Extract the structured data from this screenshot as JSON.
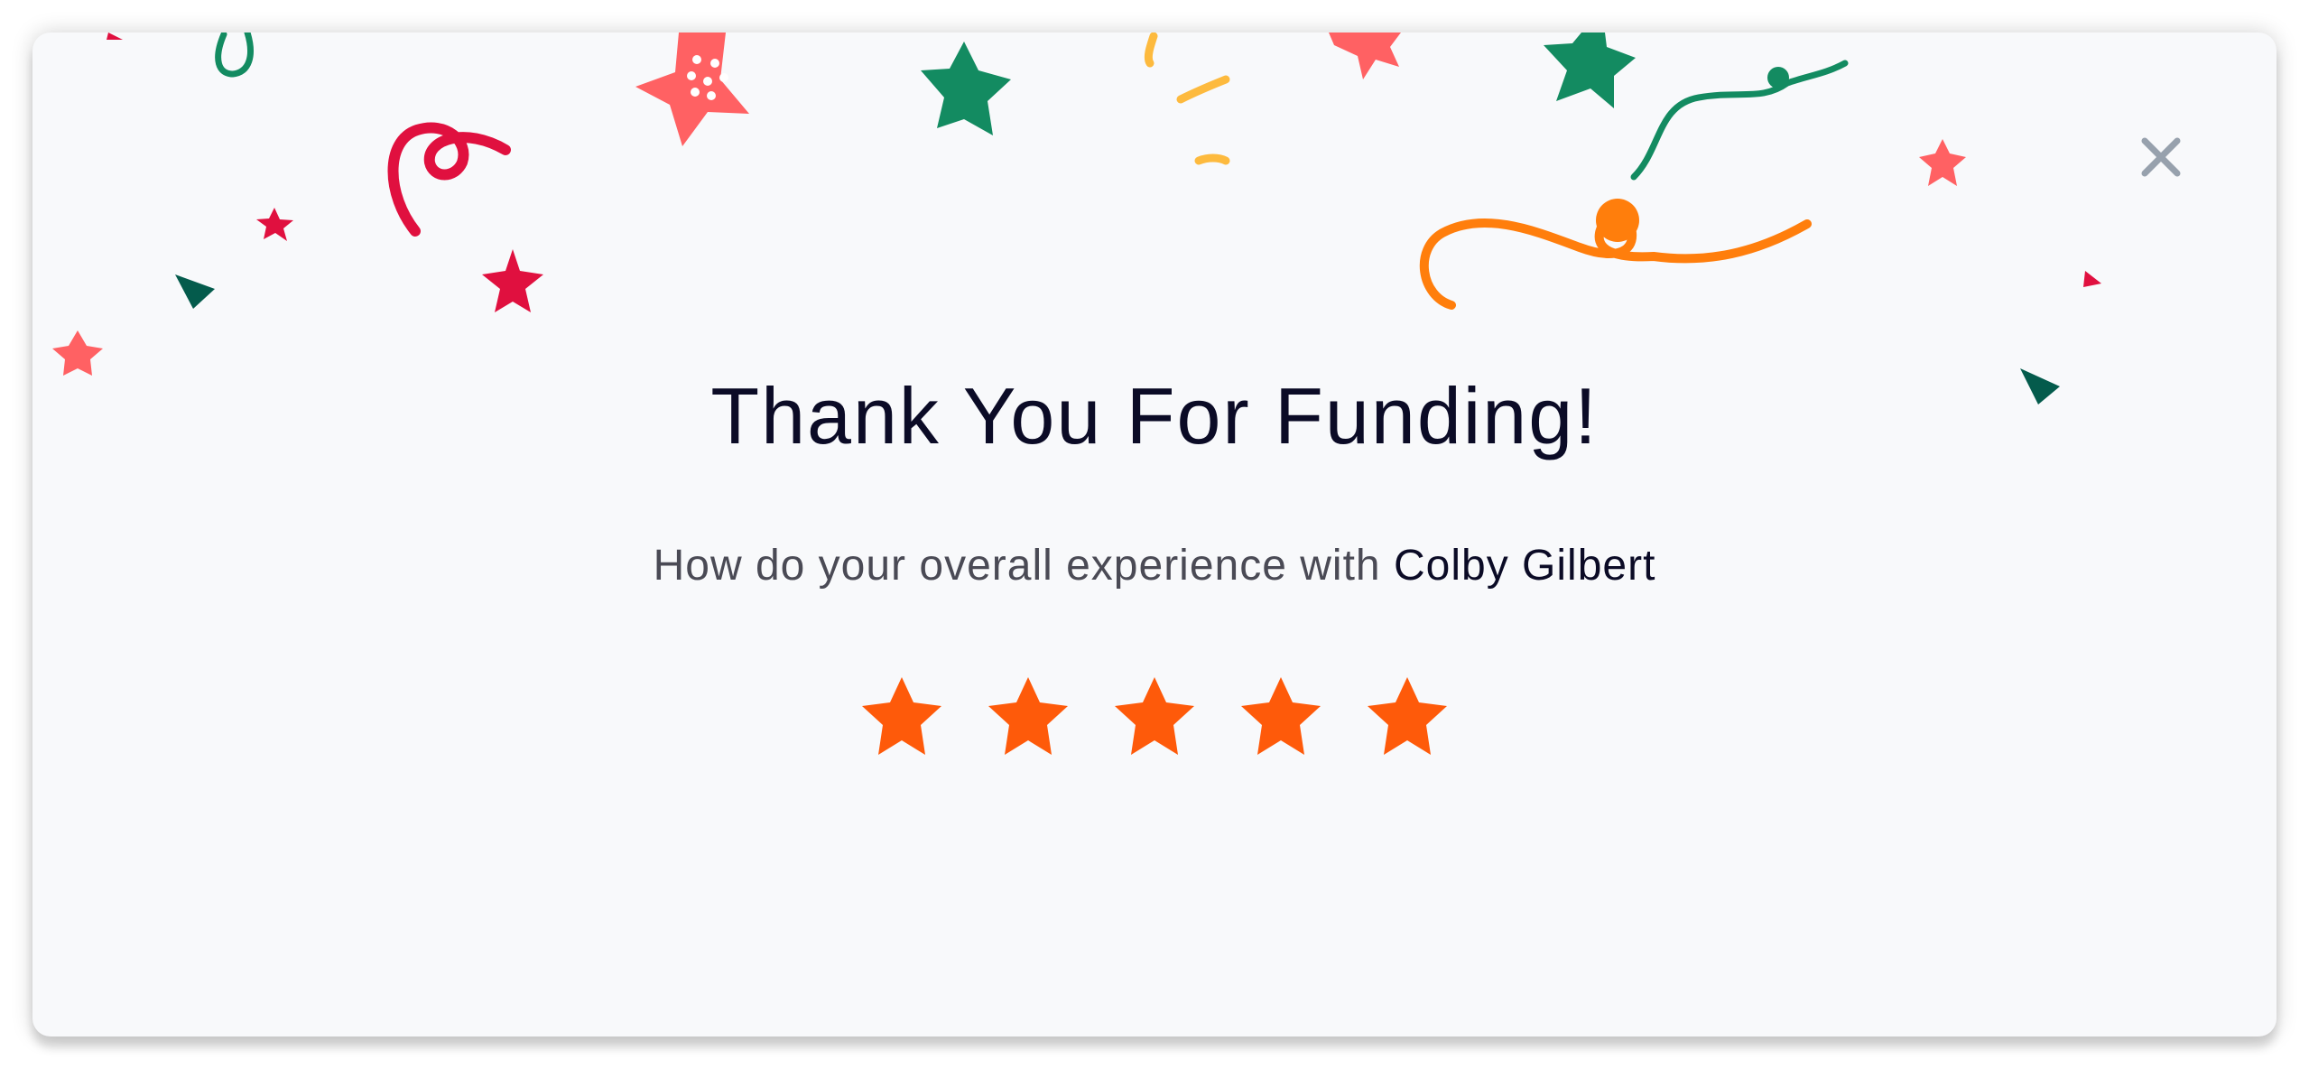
{
  "dialog": {
    "title": "Thank You For Funding!",
    "question": "How do your overall experience with",
    "person_name": "Colby Gilbert",
    "close_icon": "close-icon"
  },
  "rating": {
    "value": 5,
    "max": 5,
    "star_color": "#fe5a0a",
    "star_icon": "star-icon"
  },
  "colors": {
    "background": "#f8f9fb",
    "title": "#0b0b26",
    "subtitle": "#4a4a55",
    "close_icon": "#97a1ad",
    "confetti": [
      "#e0103f",
      "#ff6163",
      "#138b61",
      "#045b4c",
      "#fdba3e",
      "#ff7e0c"
    ]
  }
}
